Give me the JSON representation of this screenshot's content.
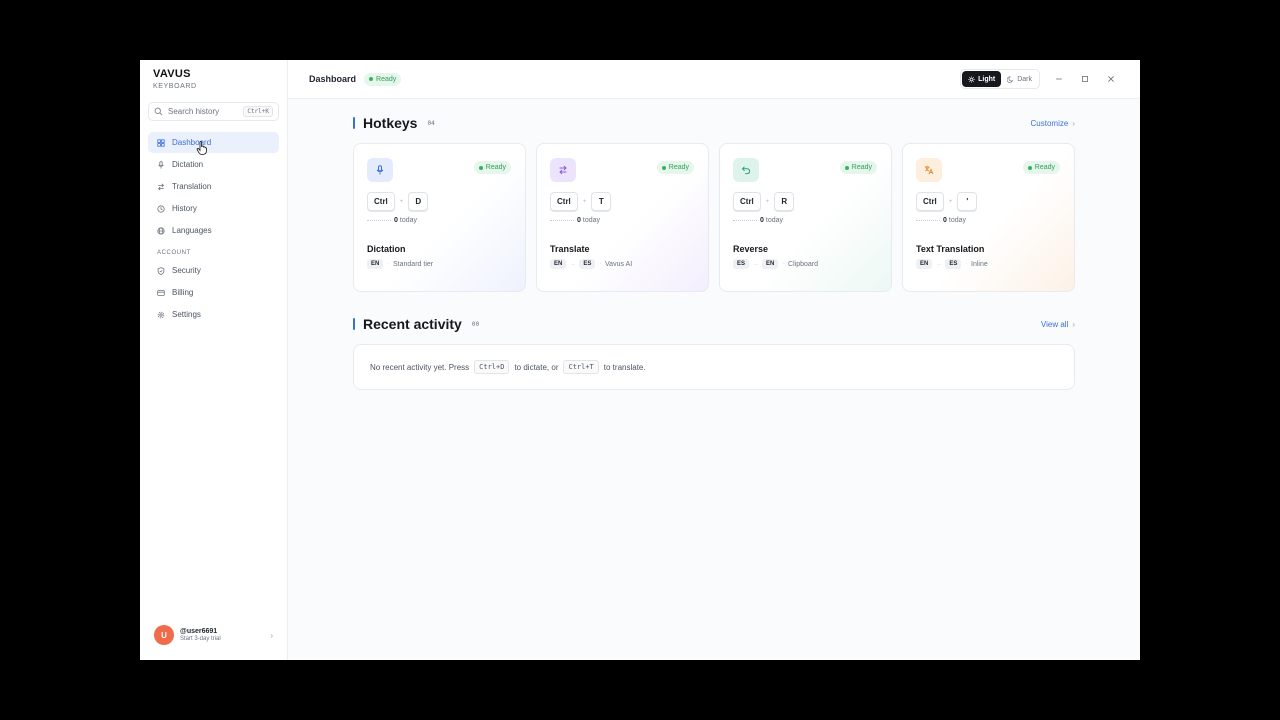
{
  "brand": {
    "name": "VAVUS",
    "subtitle": "KEYBOARD"
  },
  "search": {
    "placeholder": "Search history",
    "shortcut": "Ctrl+K"
  },
  "sidebar": {
    "items": [
      {
        "label": "Dashboard",
        "icon": "grid-icon"
      },
      {
        "label": "Dictation",
        "icon": "mic-icon"
      },
      {
        "label": "Translation",
        "icon": "swap-icon"
      },
      {
        "label": "History",
        "icon": "clock-icon"
      },
      {
        "label": "Languages",
        "icon": "globe-icon"
      }
    ],
    "account_section": "ACCOUNT",
    "account_items": [
      {
        "label": "Security",
        "icon": "shield-icon"
      },
      {
        "label": "Billing",
        "icon": "card-icon"
      },
      {
        "label": "Settings",
        "icon": "gear-icon"
      }
    ]
  },
  "user": {
    "initial": "U",
    "name": "@user6691",
    "subtitle": "Start 3-day trial"
  },
  "topbar": {
    "title": "Dashboard",
    "status": "Ready",
    "theme": {
      "light": "Light",
      "dark": "Dark",
      "selected": "Light"
    }
  },
  "hotkeys": {
    "title": "Hotkeys",
    "count": "04",
    "link": "Customize",
    "today_label": "today",
    "cards": [
      {
        "title": "Dictation",
        "status": "Ready",
        "key1": "Ctrl",
        "key2": "D",
        "count": "0",
        "lang1": "EN",
        "lang2": "",
        "meta": "Standard tier",
        "icon": "mic-icon"
      },
      {
        "title": "Translate",
        "status": "Ready",
        "key1": "Ctrl",
        "key2": "T",
        "count": "0",
        "lang1": "EN",
        "lang2": "ES",
        "meta": "Vavus AI",
        "icon": "swap-icon"
      },
      {
        "title": "Reverse",
        "status": "Ready",
        "key1": "Ctrl",
        "key2": "R",
        "count": "0",
        "lang1": "ES",
        "lang2": "EN",
        "meta": "Clipboard",
        "icon": "undo-icon"
      },
      {
        "title": "Text Translation",
        "status": "Ready",
        "key1": "Ctrl",
        "key2": "'",
        "count": "0",
        "lang1": "EN",
        "lang2": "ES",
        "meta": "Inline",
        "icon": "translate-icon"
      }
    ]
  },
  "activity": {
    "title": "Recent activity",
    "count": "00",
    "link": "View all",
    "empty_part1": "No recent activity yet. Press",
    "kbd1": "Ctrl+D",
    "empty_part2": "to dictate, or",
    "kbd2": "Ctrl+T",
    "empty_part3": "to translate."
  },
  "colors": {
    "accent": "#3b6fd8",
    "ready": "#2f9e55",
    "avatar": "#ef6b4a"
  }
}
